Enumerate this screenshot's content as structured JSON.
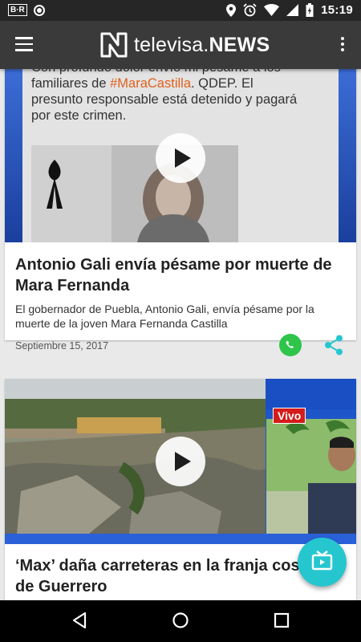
{
  "statusbar": {
    "time": "15:19",
    "badge_text": "B·R"
  },
  "appbar": {
    "logo_text_light": "televisa.",
    "logo_text_bold": "NEWS"
  },
  "articles": [
    {
      "thumb_caption_lines": [
        "Con profundo dolor envío mi pésame a los",
        "familiares de #MaraCastilla. QDEP. El",
        "presunto responsable está detenido y pagará",
        "por este crimen."
      ],
      "hashtag": "#MaraCastilla",
      "title": "Antonio Gali envía pésame por muerte de Mara Fernanda",
      "summary": "El gobernador de Puebla, Antonio Gali, envía pésame por la muerte de la joven Mara Fernanda Castilla",
      "date": "Septiembre 15, 2017"
    },
    {
      "live_label": "Vivo",
      "title": "‘Max’ daña carreteras en la franja costera de Guerrero"
    }
  ],
  "colors": {
    "accent": "#26c6cf",
    "whatsapp": "#2fc44a",
    "appbar": "#3a3a3a",
    "live_red": "#d51b1b"
  },
  "icons": [
    "menu-icon",
    "more-vert-icon",
    "play-icon",
    "whatsapp-icon",
    "share-icon",
    "tv-icon",
    "back-icon",
    "home-icon",
    "recents-icon"
  ]
}
